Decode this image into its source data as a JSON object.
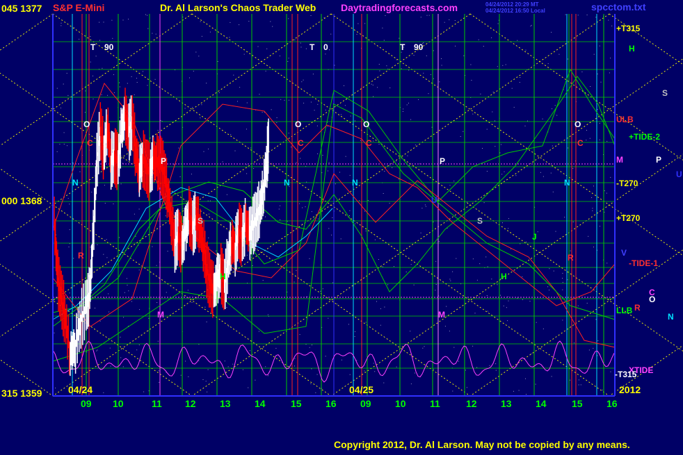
{
  "header": {
    "price_top": "045 1377",
    "title_left": "S&P E-Mini",
    "title_center": "Dr. Al Larson's Chaos Trader Web",
    "site": "Daytradingforecasts.com",
    "date_line1": "04/24/2012 20:29 MT",
    "date_line2": "04/24/2012 16:50 Local",
    "filename": "spcctom.txt"
  },
  "y_axis": {
    "labels": [
      "045 1377",
      "000 1368",
      "315 1359"
    ],
    "values": [
      1377,
      1368,
      1359
    ]
  },
  "x_axis": {
    "day1_date": "04/24",
    "day2_date": "04/25",
    "year": "2012",
    "day1_hours": [
      "09",
      "10",
      "11",
      "12",
      "13",
      "14",
      "15",
      "16"
    ],
    "day2_hours": [
      "09",
      "10",
      "11",
      "12",
      "13",
      "14",
      "15",
      "16"
    ]
  },
  "right_labels": [
    {
      "text": "+T315",
      "color": "#ffff00"
    },
    {
      "text": "H",
      "color": "#00ff00"
    },
    {
      "text": "S",
      "color": "#c0c0c0"
    },
    {
      "text": "ULB",
      "color": "#ff3030"
    },
    {
      "text": "+TIDE-2",
      "color": "#00ff00"
    },
    {
      "text": "M",
      "color": "#ff40ff"
    },
    {
      "text": "P",
      "color": "#ffffff"
    },
    {
      "text": "U",
      "color": "#3030ff"
    },
    {
      "text": "-T270",
      "color": "#ffff00"
    },
    {
      "text": "+T270",
      "color": "#ffff00"
    },
    {
      "text": "V",
      "color": "#4040ff"
    },
    {
      "text": "-TIDE-1",
      "color": "#ff3030"
    },
    {
      "text": "C",
      "color": "#ff40ff"
    },
    {
      "text": "R",
      "color": "#ff3030"
    },
    {
      "text": "O",
      "color": "#ffffff"
    },
    {
      "text": "LLB",
      "color": "#00ff00"
    },
    {
      "text": "N",
      "color": "#00e0ff"
    },
    {
      "text": "XTIDE",
      "color": "#ff40ff"
    },
    {
      "text": "-T315",
      "color": "#ffffff"
    }
  ],
  "chart_labels": [
    {
      "text": "T",
      "color": "#ffffff"
    },
    {
      "text": "90",
      "color": "#ffffff"
    },
    {
      "text": "T",
      "color": "#ffffff"
    },
    {
      "text": "0",
      "color": "#ffffff"
    },
    {
      "text": "T",
      "color": "#ffffff"
    },
    {
      "text": "90",
      "color": "#ffffff"
    },
    {
      "text": "O",
      "color": "#ffffff"
    },
    {
      "text": "O",
      "color": "#ffffff"
    },
    {
      "text": "O",
      "color": "#ffffff"
    },
    {
      "text": "O",
      "color": "#ffffff"
    },
    {
      "text": "C",
      "color": "#ff3030"
    },
    {
      "text": "C",
      "color": "#ff3030"
    },
    {
      "text": "C",
      "color": "#ff3030"
    },
    {
      "text": "C",
      "color": "#ff3030"
    },
    {
      "text": "N",
      "color": "#00e0ff"
    },
    {
      "text": "N",
      "color": "#00e0ff"
    },
    {
      "text": "N",
      "color": "#00e0ff"
    },
    {
      "text": "N",
      "color": "#00e0ff"
    },
    {
      "text": "P",
      "color": "#ffffff"
    },
    {
      "text": "P",
      "color": "#ffffff"
    },
    {
      "text": "S",
      "color": "#c0c0c0"
    },
    {
      "text": "S",
      "color": "#c0c0c0"
    },
    {
      "text": "H",
      "color": "#00ff00"
    },
    {
      "text": "H",
      "color": "#00ff00"
    },
    {
      "text": "M",
      "color": "#ff40ff"
    },
    {
      "text": "M",
      "color": "#ff40ff"
    },
    {
      "text": "U",
      "color": "#3030ff"
    },
    {
      "text": "J",
      "color": "#00ff00"
    },
    {
      "text": "R",
      "color": "#ff3030"
    },
    {
      "text": "R",
      "color": "#ff3030"
    }
  ],
  "footer": {
    "copyright": "Copyright 2012, Dr. Al Larson. May not be copied by any means."
  },
  "colors": {
    "background": "#000066",
    "grid_green": "#00cc00",
    "grid_yellow": "#ffff00",
    "axis_blue": "#3030ff",
    "up_bar": "#ffffff",
    "down_bar": "#ff0000",
    "wave_magenta": "#ff40ff",
    "band_green": "#00cc00",
    "band_red": "#ff2020"
  },
  "chart_data": {
    "type": "line",
    "title": "S&P E-Mini",
    "ylim": [
      1359,
      1377
    ],
    "sessions": [
      "04/24",
      "04/25"
    ],
    "price_series": [
      {
        "t": 0.0,
        "p": 1367.2
      },
      {
        "t": 0.1,
        "p": 1364.5
      },
      {
        "t": 0.2,
        "p": 1363.6
      },
      {
        "t": 0.3,
        "p": 1362.8
      },
      {
        "t": 0.45,
        "p": 1361.0
      },
      {
        "t": 0.6,
        "p": 1361.4
      },
      {
        "t": 0.75,
        "p": 1362.6
      },
      {
        "t": 0.9,
        "p": 1363.2
      },
      {
        "t": 1.0,
        "p": 1363.8
      },
      {
        "t": 1.1,
        "p": 1366.5
      },
      {
        "t": 1.2,
        "p": 1370.0
      },
      {
        "t": 1.3,
        "p": 1371.6
      },
      {
        "t": 1.4,
        "p": 1370.4
      },
      {
        "t": 1.5,
        "p": 1371.8
      },
      {
        "t": 1.6,
        "p": 1370.1
      },
      {
        "t": 1.7,
        "p": 1370.3
      },
      {
        "t": 1.8,
        "p": 1370.0
      },
      {
        "t": 1.9,
        "p": 1371.5
      },
      {
        "t": 2.0,
        "p": 1372.2
      },
      {
        "t": 2.1,
        "p": 1371.4
      },
      {
        "t": 2.2,
        "p": 1372.0
      },
      {
        "t": 2.3,
        "p": 1370.5
      },
      {
        "t": 2.4,
        "p": 1369.6
      },
      {
        "t": 2.5,
        "p": 1370.2
      },
      {
        "t": 2.6,
        "p": 1369.8
      },
      {
        "t": 2.7,
        "p": 1369.5
      },
      {
        "t": 2.8,
        "p": 1370.1
      },
      {
        "t": 2.9,
        "p": 1370.0
      },
      {
        "t": 3.0,
        "p": 1369.9
      },
      {
        "t": 3.1,
        "p": 1369.5
      },
      {
        "t": 3.2,
        "p": 1368.6
      },
      {
        "t": 3.3,
        "p": 1367.4
      },
      {
        "t": 3.4,
        "p": 1366.2
      },
      {
        "t": 3.5,
        "p": 1366.6
      },
      {
        "t": 3.6,
        "p": 1366.0
      },
      {
        "t": 3.7,
        "p": 1366.8
      },
      {
        "t": 3.8,
        "p": 1367.5
      },
      {
        "t": 3.9,
        "p": 1366.9
      },
      {
        "t": 4.0,
        "p": 1367.4
      },
      {
        "t": 4.1,
        "p": 1367.0
      },
      {
        "t": 4.2,
        "p": 1366.2
      },
      {
        "t": 4.3,
        "p": 1365.0
      },
      {
        "t": 4.4,
        "p": 1364.3
      },
      {
        "t": 4.5,
        "p": 1363.9
      },
      {
        "t": 4.6,
        "p": 1364.5
      },
      {
        "t": 4.7,
        "p": 1364.8
      },
      {
        "t": 4.8,
        "p": 1364.2
      },
      {
        "t": 4.9,
        "p": 1365.4
      },
      {
        "t": 5.0,
        "p": 1366.3
      },
      {
        "t": 5.1,
        "p": 1366.0
      },
      {
        "t": 5.2,
        "p": 1366.8
      },
      {
        "t": 5.3,
        "p": 1366.4
      },
      {
        "t": 5.4,
        "p": 1367.1
      },
      {
        "t": 5.5,
        "p": 1366.6
      },
      {
        "t": 5.6,
        "p": 1367.0
      },
      {
        "t": 5.7,
        "p": 1367.4
      },
      {
        "t": 5.8,
        "p": 1367.9
      },
      {
        "t": 5.9,
        "p": 1368.8
      },
      {
        "t": 6.0,
        "p": 1370.2
      },
      {
        "t": 6.05,
        "p": 1371.0
      }
    ]
  }
}
